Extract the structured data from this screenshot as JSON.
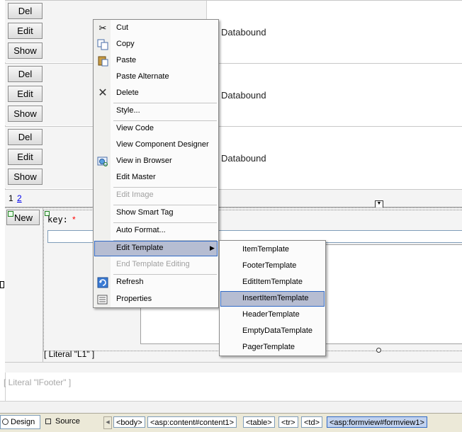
{
  "grid": {
    "rows": [
      {
        "del": "Del",
        "edit": "Edit",
        "show": "Show",
        "cell": "Databound"
      },
      {
        "del": "Del",
        "edit": "Edit",
        "show": "Show",
        "cell": "Databound"
      },
      {
        "del": "Del",
        "edit": "Edit",
        "show": "Show",
        "cell": "Databound"
      }
    ],
    "pager": {
      "page1": "1",
      "page2": "2"
    }
  },
  "formview": {
    "new_button": "New",
    "key_label": "key:",
    "required_mark": "*",
    "literal_l1": "Literal \"L1\"",
    "literal_footer": "Literal \"lFooter\""
  },
  "context_menu": {
    "items": [
      {
        "label": "Cut",
        "icon": "scissors-icon"
      },
      {
        "label": "Copy",
        "icon": "copy-icon"
      },
      {
        "label": "Paste",
        "icon": "paste-icon"
      },
      {
        "label": "Paste Alternate"
      },
      {
        "label": "Delete",
        "icon": "delete-x-icon"
      },
      {
        "label": "Style..."
      },
      {
        "label": "View Code"
      },
      {
        "label": "View Component Designer"
      },
      {
        "label": "View in Browser",
        "icon": "browser-icon"
      },
      {
        "label": "Edit Master"
      },
      {
        "label": "Edit Image",
        "disabled": true
      },
      {
        "label": "Show Smart Tag"
      },
      {
        "label": "Auto Format..."
      },
      {
        "label": "Edit Template",
        "submenu": true,
        "highlighted": true
      },
      {
        "label": "End Template Editing",
        "disabled": true
      },
      {
        "label": "Refresh",
        "icon": "refresh-icon"
      },
      {
        "label": "Properties",
        "icon": "properties-icon"
      }
    ]
  },
  "template_submenu": {
    "items": [
      {
        "label": "ItemTemplate"
      },
      {
        "label": "FooterTemplate"
      },
      {
        "label": "EditItemTemplate"
      },
      {
        "label": "InsertItemTemplate",
        "highlighted": true
      },
      {
        "label": "HeaderTemplate"
      },
      {
        "label": "EmptyDataTemplate"
      },
      {
        "label": "PagerTemplate"
      }
    ]
  },
  "statusbar": {
    "design_tab": "Design",
    "source_tab": "Source",
    "breadcrumbs": [
      "<body>",
      "<asp:content#content1>",
      "<table>",
      "<tr>",
      "<td>",
      "<asp:formview#formview1>"
    ]
  },
  "colors": {
    "menu_highlight": "#b6bdd2",
    "menu_highlight_border": "#316ac5",
    "required_star": "#ff0000",
    "link": "#0000ee"
  }
}
